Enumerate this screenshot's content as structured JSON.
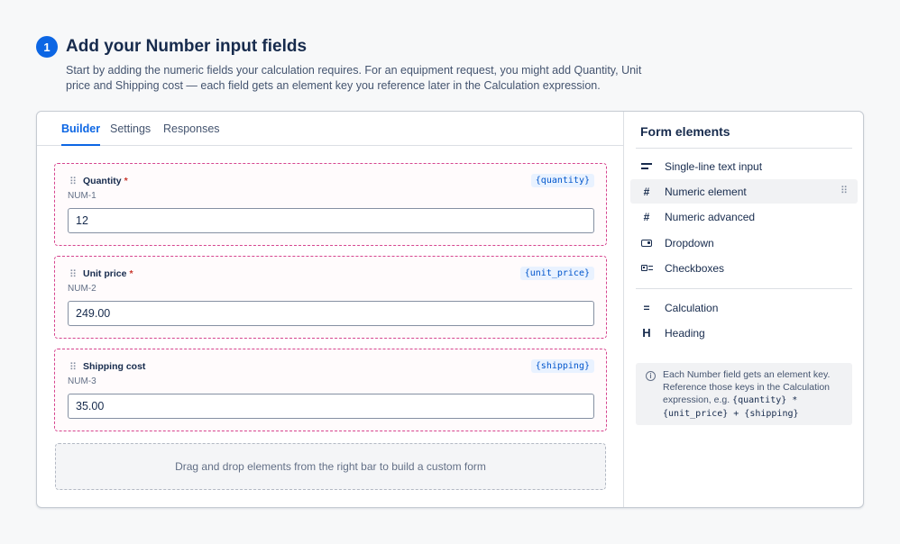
{
  "step": {
    "number": "1",
    "title": "Add your Number input fields",
    "description": "Start by adding the numeric fields your calculation requires. For an equipment request, you might add Quantity, Unit price and Shipping cost — each field gets an element key you reference later in the Calculation expression."
  },
  "tabs": [
    "Builder",
    "Settings",
    "Responses"
  ],
  "active_tab": "Builder",
  "fields": [
    {
      "label": "Quantity",
      "required": "*",
      "code": "NUM-1",
      "key": "{quantity}",
      "value": "12"
    },
    {
      "label": "Unit price",
      "required": "*",
      "code": "NUM-2",
      "key": "{unit_price}",
      "value": "249.00"
    },
    {
      "label": "Shipping cost",
      "required": "",
      "code": "NUM-3",
      "key": "{shipping}",
      "value": "35.00"
    }
  ],
  "drop_zone": {
    "text": "Drag and drop elements from the right bar to build a custom form"
  },
  "sidebar": {
    "title": "Form elements",
    "items": [
      {
        "label": "Single-line text input",
        "icon": "text-lines-icon"
      },
      {
        "label": "Numeric element",
        "icon": "hash-icon"
      },
      {
        "label": "Numeric advanced",
        "icon": "hash-icon"
      },
      {
        "label": "Dropdown",
        "icon": "dropdown-icon"
      },
      {
        "label": "Checkboxes",
        "icon": "checkbox-icon"
      },
      {
        "label": "Calculation",
        "icon": "equals-icon"
      },
      {
        "label": "Heading",
        "icon": "heading-icon"
      }
    ],
    "info": {
      "text_before": "Each Number field gets an element key. Reference those keys in the Calculation expression, e.g. ",
      "expression": "{quantity} * {unit_price} + {shipping}"
    }
  },
  "colors": {
    "accent": "#0c66e4",
    "field_border": "#d6458f",
    "required": "#c9372c",
    "key_chip_bg": "#e9f2ff"
  }
}
